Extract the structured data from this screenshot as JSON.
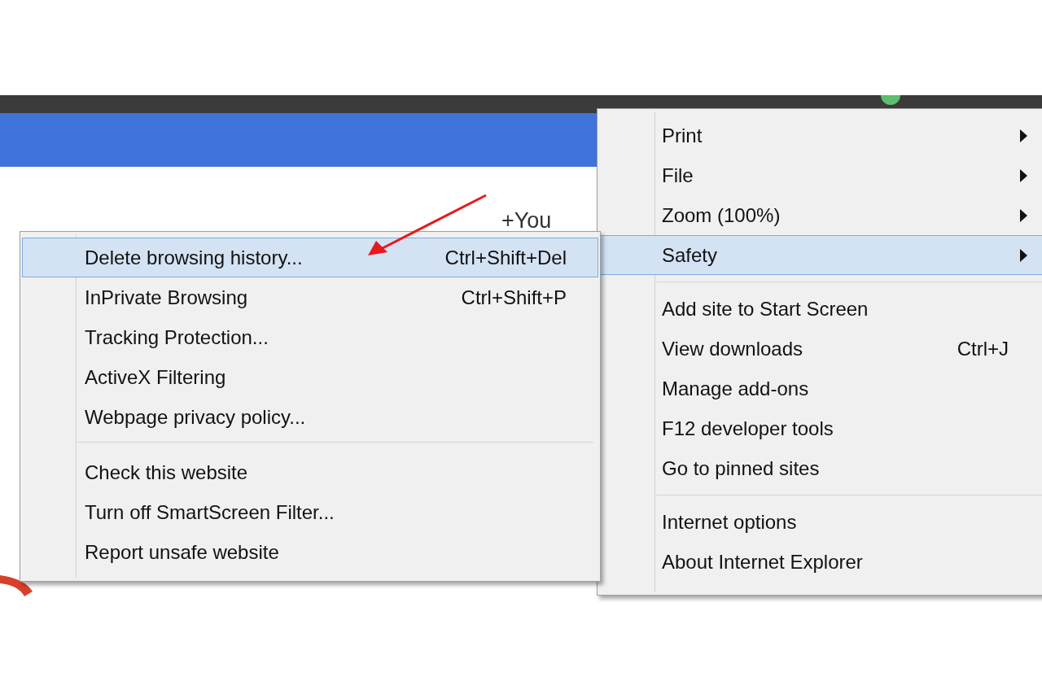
{
  "page": {
    "user_link": "+You"
  },
  "main_menu": {
    "groups": [
      [
        {
          "label": "Print",
          "has_submenu": true,
          "selected": false
        },
        {
          "label": "File",
          "has_submenu": true,
          "selected": false
        },
        {
          "label": "Zoom (100%)",
          "has_submenu": true,
          "selected": false
        },
        {
          "label": "Safety",
          "has_submenu": true,
          "selected": true
        }
      ],
      [
        {
          "label": "Add site to Start Screen",
          "has_submenu": false,
          "selected": false
        },
        {
          "label": "View downloads",
          "shortcut": "Ctrl+J",
          "has_submenu": false,
          "selected": false
        },
        {
          "label": "Manage add-ons",
          "has_submenu": false,
          "selected": false
        },
        {
          "label": "F12 developer tools",
          "has_submenu": false,
          "selected": false
        },
        {
          "label": "Go to pinned sites",
          "has_submenu": false,
          "selected": false
        }
      ],
      [
        {
          "label": "Internet options",
          "has_submenu": false,
          "selected": false
        },
        {
          "label": "About Internet Explorer",
          "has_submenu": false,
          "selected": false
        }
      ]
    ]
  },
  "safety_submenu": {
    "groups": [
      [
        {
          "label": "Delete browsing history...",
          "shortcut": "Ctrl+Shift+Del",
          "selected": true
        },
        {
          "label": "InPrivate Browsing",
          "shortcut": "Ctrl+Shift+P",
          "selected": false
        },
        {
          "label": "Tracking Protection...",
          "selected": false
        },
        {
          "label": "ActiveX Filtering",
          "selected": false
        },
        {
          "label": "Webpage privacy policy...",
          "selected": false
        }
      ],
      [
        {
          "label": "Check this website",
          "selected": false
        },
        {
          "label": "Turn off SmartScreen Filter...",
          "selected": false
        },
        {
          "label": "Report unsafe website",
          "selected": false
        }
      ]
    ]
  }
}
